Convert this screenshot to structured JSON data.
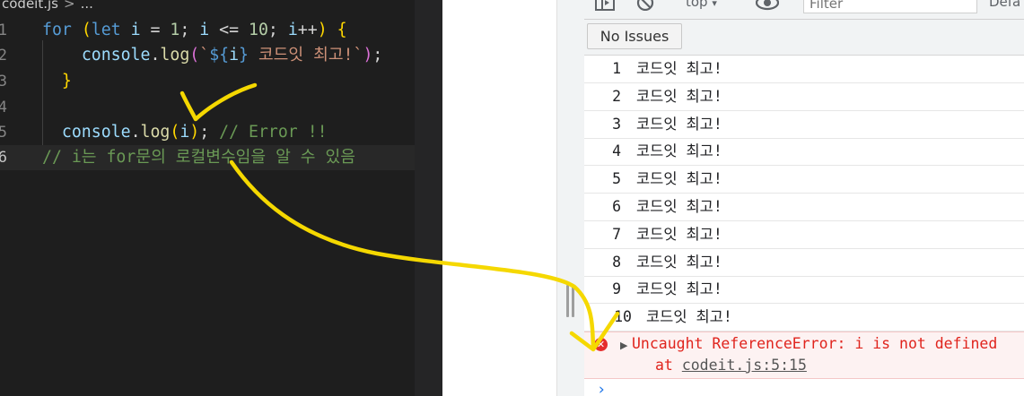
{
  "editor": {
    "breadcrumb": {
      "file": "codeit.js",
      "separator": ">",
      "trail": "..."
    },
    "lines": [
      {
        "n": "1",
        "tokens": [
          [
            "kw",
            "for"
          ],
          [
            "op",
            " "
          ],
          [
            "br1",
            "("
          ],
          [
            "kw",
            "let"
          ],
          [
            "var",
            " i"
          ],
          [
            "op",
            " = "
          ],
          [
            "num",
            "1"
          ],
          [
            "op",
            "; "
          ],
          [
            "var",
            "i"
          ],
          [
            "op",
            " <= "
          ],
          [
            "num",
            "10"
          ],
          [
            "op",
            "; "
          ],
          [
            "var",
            "i"
          ],
          [
            "op",
            "++"
          ],
          [
            "br1",
            ")"
          ],
          [
            "op",
            " "
          ],
          [
            "br1",
            "{"
          ]
        ]
      },
      {
        "n": "2",
        "tokens": [
          [
            "op",
            "    "
          ],
          [
            "var",
            "console"
          ],
          [
            "op",
            "."
          ],
          [
            "fn",
            "log"
          ],
          [
            "br2",
            "("
          ],
          [
            "tq",
            "`"
          ],
          [
            "tpl",
            "${"
          ],
          [
            "var",
            "i"
          ],
          [
            "tpl",
            "}"
          ],
          [
            "str",
            " 코드잇 최고!"
          ],
          [
            "tq",
            "`"
          ],
          [
            "br2",
            ")"
          ],
          [
            "op",
            ";"
          ]
        ]
      },
      {
        "n": "3",
        "tokens": [
          [
            "op",
            "  "
          ],
          [
            "br1",
            "}"
          ]
        ]
      },
      {
        "n": "4",
        "tokens": []
      },
      {
        "n": "5",
        "tokens": [
          [
            "op",
            "  "
          ],
          [
            "var",
            "console"
          ],
          [
            "op",
            "."
          ],
          [
            "fn",
            "log"
          ],
          [
            "br1",
            "("
          ],
          [
            "var",
            "i"
          ],
          [
            "br1",
            ")"
          ],
          [
            "op",
            "; "
          ],
          [
            "com",
            "// Error !!"
          ]
        ]
      },
      {
        "n": "6",
        "tokens": [
          [
            "com",
            "// i는 for문의 로컬변수임을 알 수 있음"
          ]
        ]
      }
    ]
  },
  "console": {
    "toolbar": {
      "context": "top",
      "context_arrow": "▾",
      "filter_placeholder": "Filter",
      "levels": "Defa",
      "icons": [
        "sidebar-toggle-icon",
        "clear-console-icon",
        "eye-icon"
      ]
    },
    "issues_button": "No Issues",
    "logs": [
      {
        "n": "1",
        "text": "코드잇 최고!"
      },
      {
        "n": "2",
        "text": "코드잇 최고!"
      },
      {
        "n": "3",
        "text": "코드잇 최고!"
      },
      {
        "n": "4",
        "text": "코드잇 최고!"
      },
      {
        "n": "5",
        "text": "코드잇 최고!"
      },
      {
        "n": "6",
        "text": "코드잇 최고!"
      },
      {
        "n": "7",
        "text": "코드잇 최고!"
      },
      {
        "n": "8",
        "text": "코드잇 최고!"
      },
      {
        "n": "9",
        "text": "코드잇 최고!"
      },
      {
        "n": "10",
        "text": "코드잇 최고!"
      }
    ],
    "error": {
      "icon": "✕",
      "expand": "▶",
      "message": "Uncaught ReferenceError: i is not defined",
      "at": "at ",
      "location": "codeit.js:5:15"
    },
    "prompt": "›"
  },
  "annotation": {
    "color": "#f5d800"
  }
}
